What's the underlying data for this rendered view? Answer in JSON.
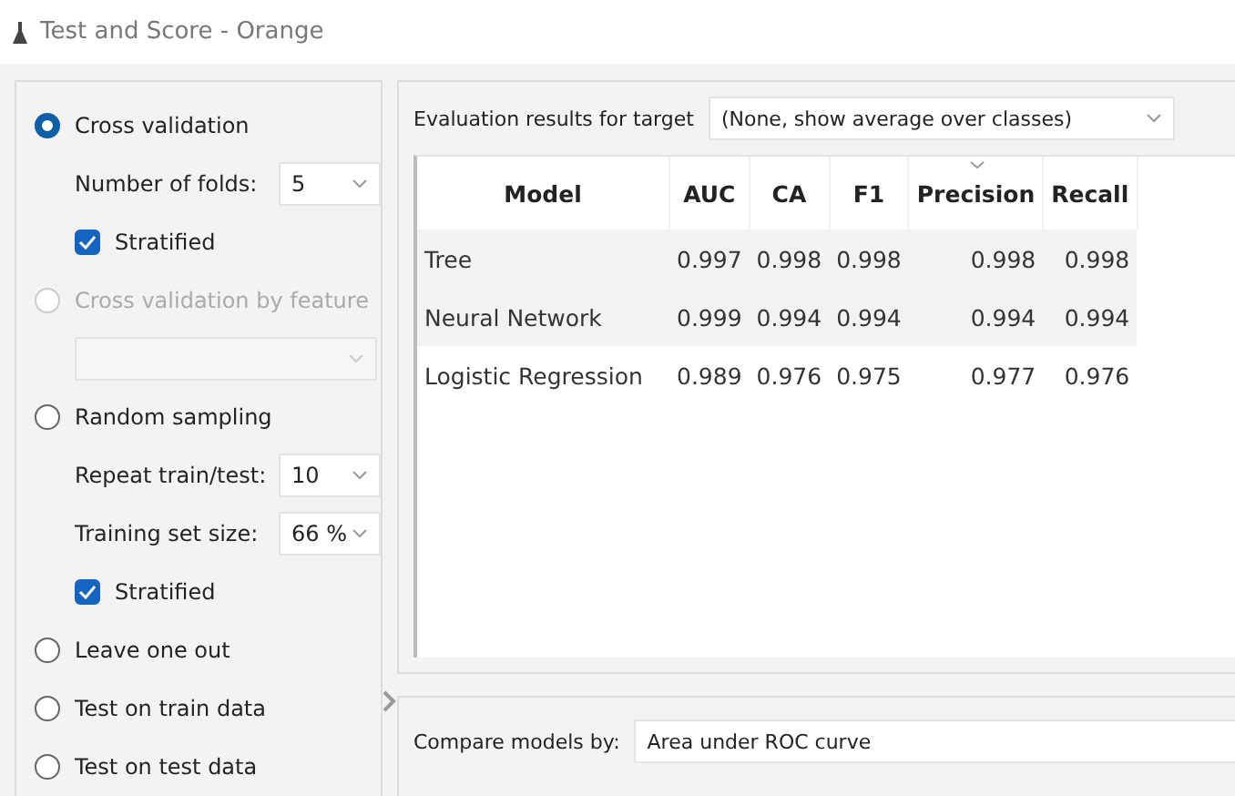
{
  "window": {
    "title": "Test and Score - Orange"
  },
  "sampling": [
    {
      "kind": "radio",
      "label": "Cross validation",
      "selected": true,
      "disabled": false
    },
    {
      "kind": "combo",
      "label": "Number of folds:",
      "value": "5"
    },
    {
      "kind": "checkbox",
      "label": "Stratified",
      "checked": true
    },
    {
      "kind": "radio",
      "label": "Cross validation by feature",
      "selected": false,
      "disabled": true
    },
    {
      "kind": "blank_combo"
    },
    {
      "kind": "radio",
      "label": "Random sampling",
      "selected": false,
      "disabled": false
    },
    {
      "kind": "combo",
      "label": "Repeat train/test:",
      "value": "10"
    },
    {
      "kind": "combo",
      "label": "Training set size:",
      "value": "66 %"
    },
    {
      "kind": "checkbox",
      "label": "Stratified",
      "checked": true
    },
    {
      "kind": "radio",
      "label": "Leave one out",
      "selected": false,
      "disabled": false
    },
    {
      "kind": "radio",
      "label": "Test on train data",
      "selected": false,
      "disabled": false
    },
    {
      "kind": "radio",
      "label": "Test on test data",
      "selected": false,
      "disabled": false
    }
  ],
  "target": {
    "label": "Evaluation results for target",
    "value": "(None, show average over classes)"
  },
  "table": {
    "columns": [
      {
        "label": "Model",
        "sorted": false
      },
      {
        "label": "AUC",
        "sorted": false
      },
      {
        "label": "CA",
        "sorted": false
      },
      {
        "label": "F1",
        "sorted": false
      },
      {
        "label": "Precision",
        "sorted": true
      },
      {
        "label": "Recall",
        "sorted": false
      }
    ],
    "rows": [
      [
        "Tree",
        "0.997",
        "0.998",
        "0.998",
        "0.998",
        "0.998"
      ],
      [
        "Neural Network",
        "0.999",
        "0.994",
        "0.994",
        "0.994",
        "0.994"
      ],
      [
        "Logistic Regression",
        "0.989",
        "0.976",
        "0.975",
        "0.977",
        "0.976"
      ]
    ]
  },
  "compare": {
    "label": "Compare models by:",
    "value": "Area under ROC curve"
  }
}
